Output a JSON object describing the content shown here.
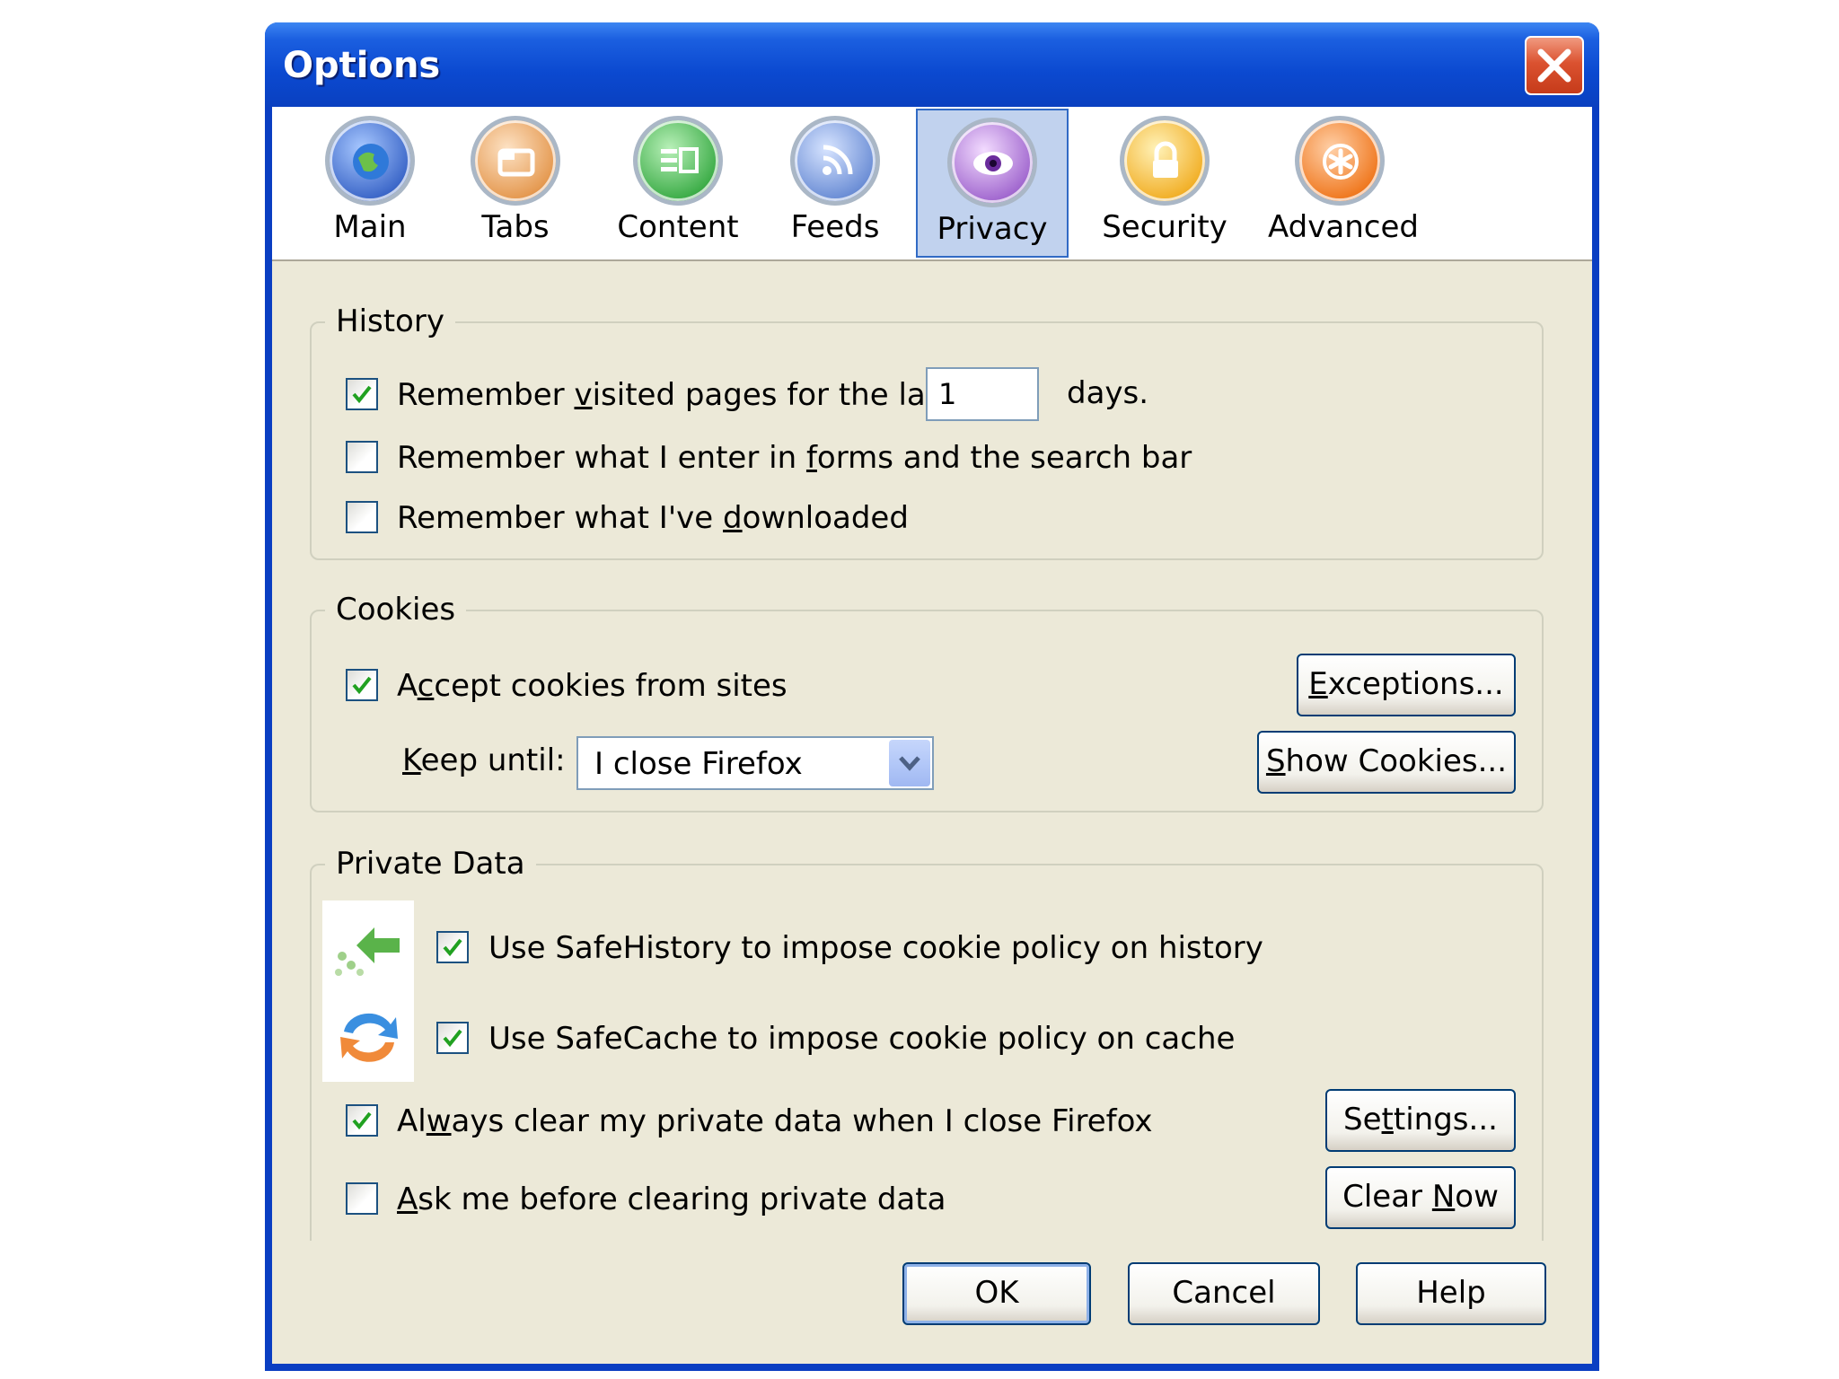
{
  "window": {
    "title": "Options"
  },
  "toolbar": {
    "tabs": [
      {
        "label": "Main",
        "icon": "main-globe-icon"
      },
      {
        "label": "Tabs",
        "icon": "tabs-icon"
      },
      {
        "label": "Content",
        "icon": "content-icon"
      },
      {
        "label": "Feeds",
        "icon": "feeds-icon"
      },
      {
        "label": "Privacy",
        "icon": "privacy-eye-icon",
        "selected": true
      },
      {
        "label": "Security",
        "icon": "security-lock-icon"
      },
      {
        "label": "Advanced",
        "icon": "advanced-gear-icon"
      }
    ]
  },
  "history": {
    "legend": "History",
    "remember_visited": {
      "pre": "Remember ",
      "accel": "v",
      "post": "isited pages for the last",
      "checked": true
    },
    "days_value": "1",
    "days_suffix": "days.",
    "remember_forms": {
      "pre": "Remember what I enter in ",
      "accel": "f",
      "post": "orms and the search bar",
      "checked": false
    },
    "remember_downloads": {
      "pre": "Remember what I've ",
      "accel": "d",
      "post": "ownloaded",
      "checked": false
    }
  },
  "cookies": {
    "legend": "Cookies",
    "accept": {
      "pre": "A",
      "accel": "c",
      "post": "cept cookies from sites",
      "checked": true
    },
    "exceptions_button": {
      "accel": "E",
      "post": "xceptions..."
    },
    "keep_until": {
      "accel": "K",
      "post": "eep until:"
    },
    "keep_until_value": "I close Firefox",
    "show_cookies_button": {
      "accel": "S",
      "post": "how Cookies..."
    }
  },
  "private_data": {
    "legend": "Private Data",
    "safehistory": {
      "label": "Use SafeHistory to impose cookie policy on history",
      "checked": true
    },
    "safecache": {
      "label": "Use SafeCache to impose cookie policy on cache",
      "checked": true
    },
    "always_clear": {
      "pre": "Al",
      "accel": "w",
      "post": "ays clear my private data when I close Firefox",
      "checked": true
    },
    "settings_button": {
      "pre": "Se",
      "accel": "t",
      "post": "tings..."
    },
    "ask_before": {
      "pre": "",
      "accel": "A",
      "post": "sk me before clearing private data",
      "checked": false
    },
    "clear_now_button": {
      "pre": "Clear ",
      "accel": "N",
      "post": "ow"
    }
  },
  "footer": {
    "ok": "OK",
    "cancel": "Cancel",
    "help": "Help"
  },
  "colors": {
    "titlebar": "#0b49d0",
    "dialog_bg": "#ece9d8",
    "selected_tab": "#c1d2ee",
    "check": "#21a121"
  }
}
